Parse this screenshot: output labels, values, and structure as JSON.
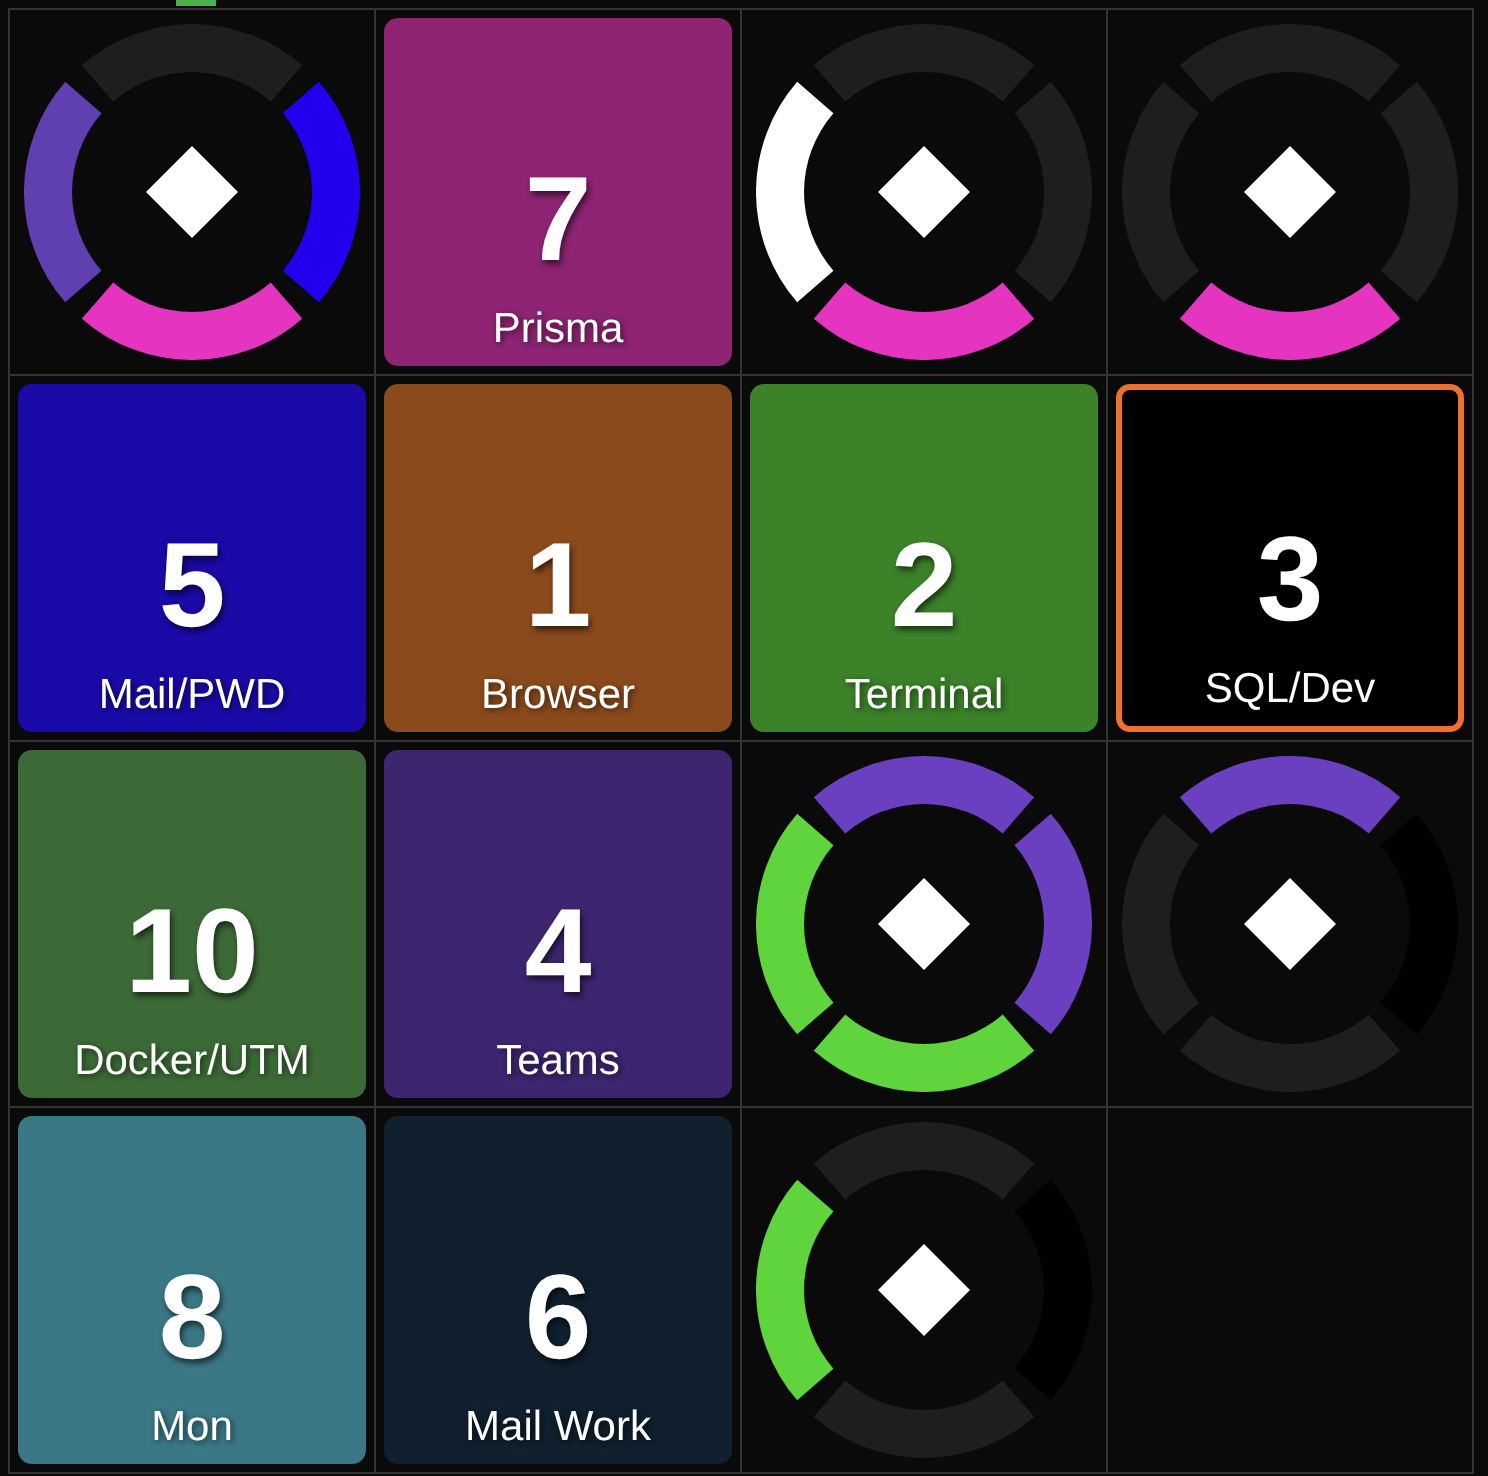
{
  "cells": [
    {
      "kind": "dial",
      "segments": [
        {
          "color": "#1e1e1e"
        },
        {
          "color": "#2200ee"
        },
        {
          "color": "#e535c0"
        },
        {
          "color": "#6040b0"
        }
      ]
    },
    {
      "kind": "button",
      "number": "7",
      "label": "Prisma",
      "color": "#8e2473",
      "selected": false
    },
    {
      "kind": "dial",
      "segments": [
        {
          "color": "#1e1e1e"
        },
        {
          "color": "#1e1e1e"
        },
        {
          "color": "#e535c0"
        },
        {
          "color": "#ffffff"
        }
      ]
    },
    {
      "kind": "dial",
      "segments": [
        {
          "color": "#1e1e1e"
        },
        {
          "color": "#1e1e1e"
        },
        {
          "color": "#e535c0"
        },
        {
          "color": "#1e1e1e"
        }
      ]
    },
    {
      "kind": "button",
      "number": "5",
      "label": "Mail/PWD",
      "color": "#1a0aa8",
      "selected": false
    },
    {
      "kind": "button",
      "number": "1",
      "label": "Browser",
      "color": "#8b4a1c",
      "selected": false
    },
    {
      "kind": "button",
      "number": "2",
      "label": "Terminal",
      "color": "#3b8228",
      "selected": false
    },
    {
      "kind": "button",
      "number": "3",
      "label": "SQL/Dev",
      "color": "#000000",
      "selected": true
    },
    {
      "kind": "button",
      "number": "10",
      "label": "Docker/UTM",
      "color": "#3c6a36",
      "selected": false
    },
    {
      "kind": "button",
      "number": "4",
      "label": "Teams",
      "color": "#3d2570",
      "selected": false
    },
    {
      "kind": "dial",
      "segments": [
        {
          "color": "#6a3fc0"
        },
        {
          "color": "#6a3fc0"
        },
        {
          "color": "#5fd43d"
        },
        {
          "color": "#5fd43d"
        }
      ]
    },
    {
      "kind": "dial",
      "segments": [
        {
          "color": "#6a3fc0"
        },
        {
          "color": "#000000"
        },
        {
          "color": "#1e1e1e"
        },
        {
          "color": "#1e1e1e"
        }
      ]
    },
    {
      "kind": "button",
      "number": "8",
      "label": "Mon",
      "color": "#3a7886",
      "selected": false
    },
    {
      "kind": "button",
      "number": "6",
      "label": "Mail Work",
      "color": "#10202e",
      "selected": false
    },
    {
      "kind": "dial",
      "segments": [
        {
          "color": "#1e1e1e"
        },
        {
          "color": "#000000"
        },
        {
          "color": "#1e1e1e"
        },
        {
          "color": "#5fd43d"
        }
      ]
    }
  ]
}
